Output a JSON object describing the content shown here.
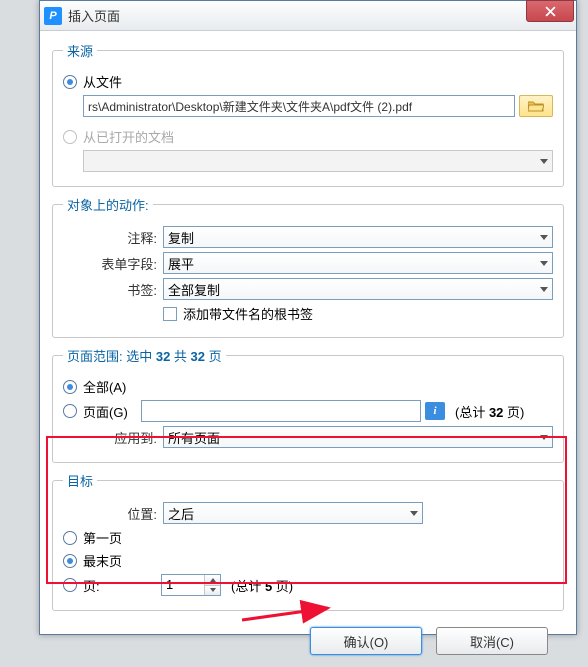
{
  "window": {
    "title": "插入页面"
  },
  "source": {
    "legend": "来源",
    "from_file_label": "从文件",
    "file_path": "rs\\Administrator\\Desktop\\新建文件夹\\文件夹A\\pdf文件 (2).pdf",
    "from_open_docs_label": "从已打开的文档"
  },
  "actions": {
    "legend": "对象上的动作:",
    "annotations_label": "注释:",
    "annotations_value": "复制",
    "form_fields_label": "表单字段:",
    "form_fields_value": "展平",
    "bookmarks_label": "书签:",
    "bookmarks_value": "全部复制",
    "checkbox_label": "添加带文件名的根书签"
  },
  "range": {
    "legend_prefix": "页面范围: 选中 ",
    "legend_mid": " 共 ",
    "legend_suffix": " 页",
    "count_selected": "32",
    "count_total": "32",
    "all_label": "全部(A)",
    "pages_label": "页面(G)",
    "total_prefix": "(总计 ",
    "total_value": "32",
    "total_suffix": " 页)",
    "apply_to_label": "应用到:",
    "apply_to_value": "所有页面"
  },
  "dest": {
    "legend": "目标",
    "position_label": "位置:",
    "position_value": "之后",
    "first_label": "第一页",
    "last_label": "最末页",
    "page_label": "页:",
    "page_value": "1",
    "total_prefix": "(总计 ",
    "total_value": "5",
    "total_suffix": " 页)"
  },
  "buttons": {
    "ok": "确认(O)",
    "cancel": "取消(C)"
  }
}
